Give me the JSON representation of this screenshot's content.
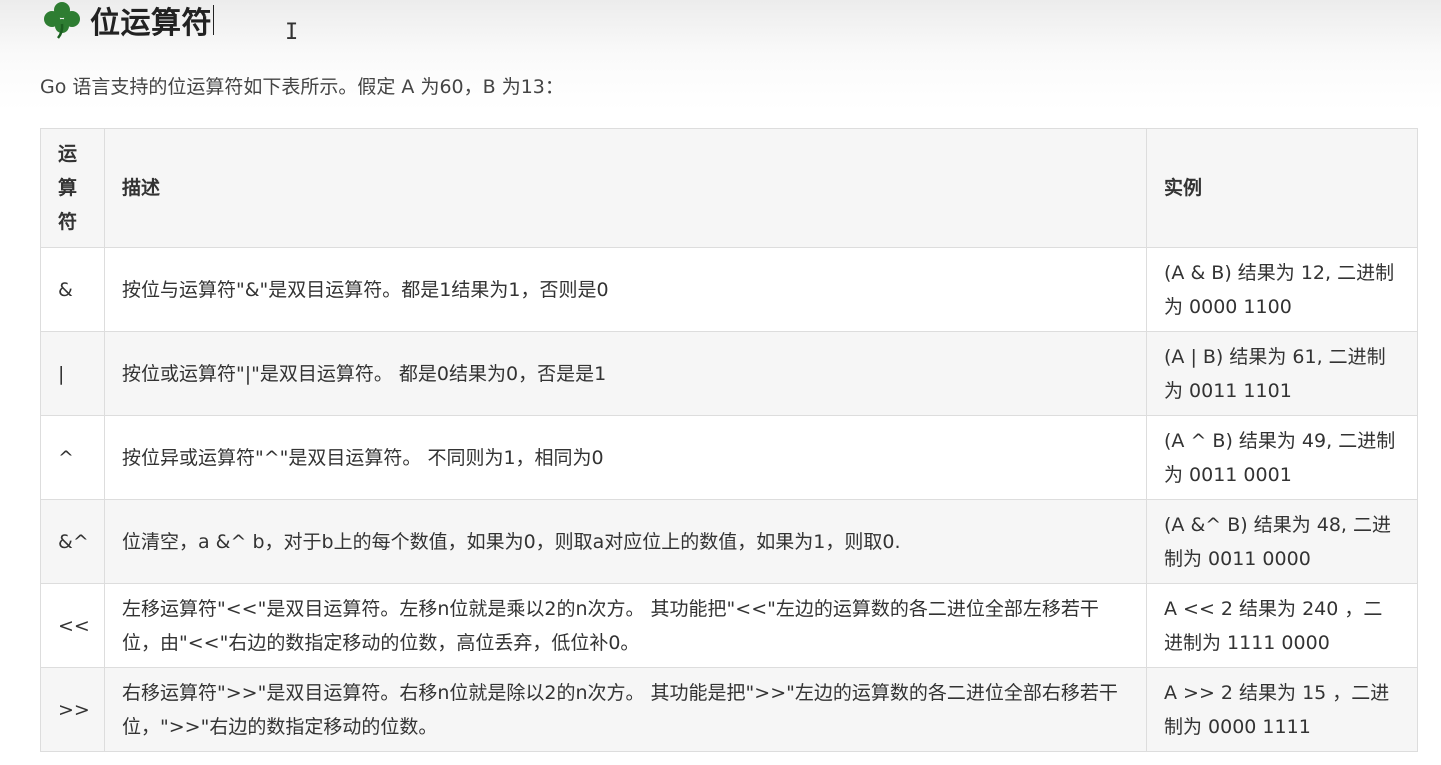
{
  "heading": {
    "title": "位运算符"
  },
  "intro": "Go 语言支持的位运算符如下表所示。假定 A 为60，B 为13：",
  "table": {
    "headers": {
      "operator": [
        "运",
        "算",
        "符"
      ],
      "description": "描述",
      "example": "实例"
    },
    "rows": [
      {
        "operator": "&",
        "description": "按位与运算符\"&\"是双目运算符。都是1结果为1，否则是0",
        "example": "(A & B) 结果为 12, 二进制为 0000 1100"
      },
      {
        "operator": "|",
        "description": "按位或运算符\"|\"是双目运算符。 都是0结果为0，否是是1",
        "example": "(A | B) 结果为 61, 二进制为 0011 1101"
      },
      {
        "operator": "^",
        "description": "按位异或运算符\"^\"是双目运算符。 不同则为1，相同为0",
        "example": "(A ^ B) 结果为 49, 二进制为 0011 0001"
      },
      {
        "operator": "&^",
        "description": "位清空，a &^ b，对于b上的每个数值，如果为0，则取a对应位上的数值，如果为1，则取0.",
        "example": "(A &^ B) 结果为 48, 二进制为 0011 0000"
      },
      {
        "operator": "<<",
        "description": "左移运算符\"<<\"是双目运算符。左移n位就是乘以2的n次方。 其功能把\"<<\"左边的运算数的各二进位全部左移若干位，由\"<<\"右边的数指定移动的位数，高位丢弃，低位补0。",
        "example": "A << 2 结果为 240 ，二进制为 1111 0000"
      },
      {
        "operator": ">>",
        "description": "右移运算符\">>\"是双目运算符。右移n位就是除以2的n次方。 其功能是把\">>\"左边的运算数的各二进位全部右移若干位，\">>\"右边的数指定移动的位数。",
        "example": "A >> 2 结果为 15 ，二进制为 0000 1111"
      }
    ]
  },
  "colors": {
    "clover": "#2e7d32",
    "border": "#dddddd",
    "stripe": "#f6f6f6"
  }
}
